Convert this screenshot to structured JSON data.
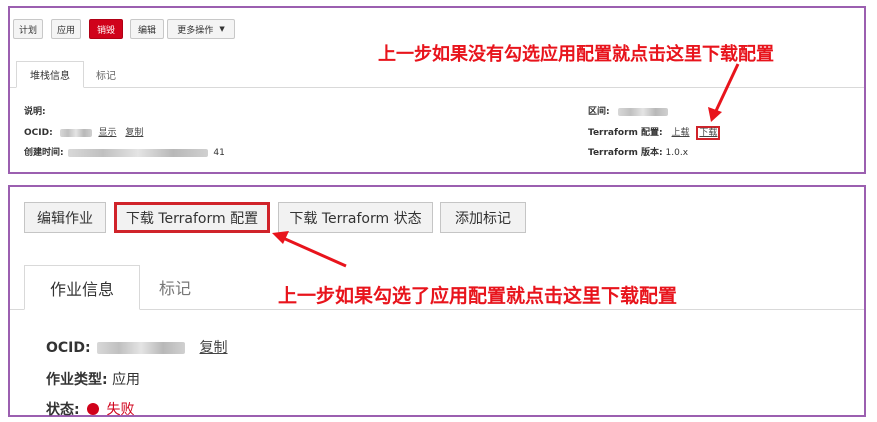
{
  "top_panel": {
    "toolbar": {
      "plan": "计划",
      "apply": "应用",
      "destroy": "销毁",
      "edit": "编辑",
      "more_actions": "更多操作",
      "caret": "▼"
    },
    "tabs": {
      "stack_info": "堆栈信息",
      "tags": "标记"
    },
    "details": {
      "description_label": "说明:",
      "ocid_label": "OCID:",
      "ocid_show": "显示",
      "ocid_copy": "复制",
      "created_label": "创建时间:",
      "created_tail": "41",
      "region_label": "区间:",
      "terraform_config_label": "Terraform 配置:",
      "terraform_config_upload": "上载",
      "terraform_config_download": "下载",
      "terraform_version_label": "Terraform 版本:",
      "terraform_version_value": "1.0.x"
    },
    "annotation": "上一步如果没有勾选应用配置就点击这里下载配置"
  },
  "bottom_panel": {
    "toolbar": {
      "edit_job": "编辑作业",
      "download_config": "下载 Terraform 配置",
      "download_state": "下载 Terraform 状态",
      "add_tags": "添加标记"
    },
    "tabs": {
      "job_info": "作业信息",
      "tags": "标记"
    },
    "details": {
      "ocid_label": "OCID:",
      "ocid_copy": "复制",
      "job_type_label": "作业类型:",
      "job_type_value": "应用",
      "status_label": "状态:",
      "status_value": "失败"
    },
    "annotation": "上一步如果勾选了应用配置就点击这里下载配置"
  },
  "colors": {
    "panel_border": "#9b5fb0",
    "annotation_red": "#e8141c",
    "danger_button": "#d0021b",
    "status_failed": "#d0021b"
  }
}
